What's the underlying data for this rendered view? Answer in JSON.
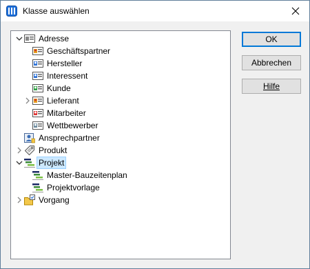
{
  "window": {
    "title": "Klasse auswählen",
    "app_icon": "grid-icon",
    "close_icon": "close-icon"
  },
  "tree": {
    "items": [
      {
        "label": "Adresse",
        "icon": "address-card-icon",
        "expanded": true
      },
      {
        "label": "Geschäftspartner",
        "icon": "address-card-orange-icon"
      },
      {
        "label": "Hersteller",
        "icon": "address-card-blue-icon"
      },
      {
        "label": "Interessent",
        "icon": "address-card-blue-icon"
      },
      {
        "label": "Kunde",
        "icon": "address-card-green-icon"
      },
      {
        "label": "Lieferant",
        "icon": "address-card-orange-icon",
        "expandable": true
      },
      {
        "label": "Mitarbeiter",
        "icon": "address-card-red-icon"
      },
      {
        "label": "Wettbewerber",
        "icon": "address-card-gray-icon"
      },
      {
        "label": "Ansprechpartner",
        "icon": "contact-icon"
      },
      {
        "label": "Produkt",
        "icon": "tag-icon",
        "expandable": true
      },
      {
        "label": "Projekt",
        "icon": "gantt-icon",
        "expanded": true,
        "selected": true
      },
      {
        "label": "Master-Bauzeitenplan",
        "icon": "gantt-icon"
      },
      {
        "label": "Projektvorlage",
        "icon": "gantt-icon"
      },
      {
        "label": "Vorgang",
        "icon": "folder-check-icon",
        "expandable": true
      }
    ]
  },
  "buttons": {
    "ok": "OK",
    "cancel": "Abbrechen",
    "help": "Hilfe"
  }
}
